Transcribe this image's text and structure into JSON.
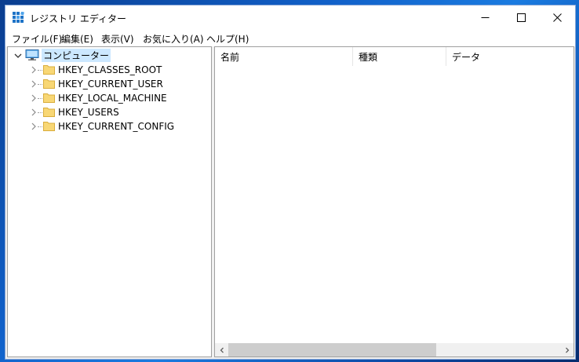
{
  "window": {
    "title": "レジストリ エディター"
  },
  "menu": [
    {
      "label": "ファイル(F)"
    },
    {
      "label": "編集(E)"
    },
    {
      "label": "表示(V)"
    },
    {
      "label": "お気に入り(A)"
    },
    {
      "label": "ヘルプ(H)"
    }
  ],
  "tree": {
    "root": "コンピューター",
    "hives": [
      {
        "label": "HKEY_CLASSES_ROOT"
      },
      {
        "label": "HKEY_CURRENT_USER"
      },
      {
        "label": "HKEY_LOCAL_MACHINE"
      },
      {
        "label": "HKEY_USERS"
      },
      {
        "label": "HKEY_CURRENT_CONFIG"
      }
    ]
  },
  "list": {
    "columns": [
      {
        "label": "名前"
      },
      {
        "label": "種類"
      },
      {
        "label": "データ"
      }
    ]
  },
  "colors": {
    "accent": "#0078d7",
    "selection": "#cce8ff",
    "folder": "#f8d775"
  }
}
